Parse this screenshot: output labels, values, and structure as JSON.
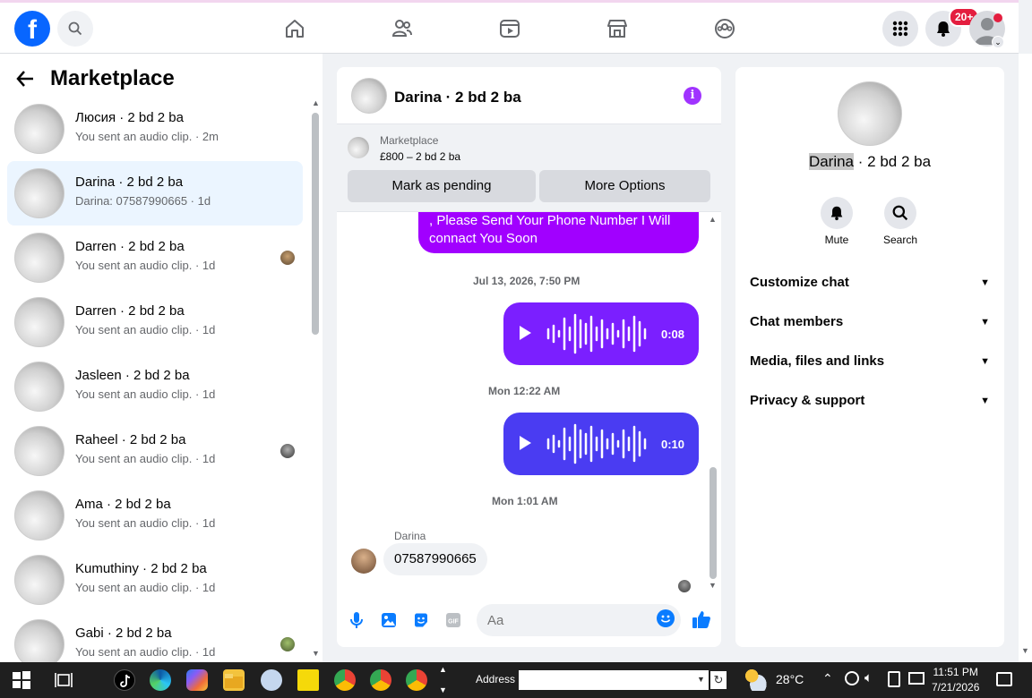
{
  "nav": {
    "logo": "f",
    "badge": "20+"
  },
  "sidebar": {
    "title": "Marketplace",
    "conversations": [
      {
        "name": "Люсия · 2 bd 2 ba",
        "sub": "You sent an audio clip. · 2m"
      },
      {
        "name": "Darina · 2 bd 2 ba",
        "sub": "Darina: 07587990665 · 1d"
      },
      {
        "name": "Darren · 2 bd 2 ba",
        "sub": "You sent an audio clip. · 1d"
      },
      {
        "name": "Darren · 2 bd 2 ba",
        "sub": "You sent an audio clip. · 1d"
      },
      {
        "name": "Jasleen · 2 bd 2 ba",
        "sub": "You sent an audio clip. · 1d"
      },
      {
        "name": "Raheel · 2 bd 2 ba",
        "sub": "You sent an audio clip. · 1d"
      },
      {
        "name": "Ama · 2 bd 2 ba",
        "sub": "You sent an audio clip. · 1d"
      },
      {
        "name": "Kumuthiny · 2 bd 2 ba",
        "sub": "You sent an audio clip. · 1d"
      },
      {
        "name": "Gabi · 2 bd 2 ba",
        "sub": "You sent an audio clip. · 1d"
      }
    ]
  },
  "chat": {
    "title": "Darina · 2 bd 2 ba",
    "marketplace_label": "Marketplace",
    "listing": "£800 – 2 bd 2 ba",
    "mark_pending": "Mark as pending",
    "more_options": "More Options",
    "sent_text": ", Please Send Your Phone Number I Will connact You Soon",
    "ts1": "Jul 13, 2026, 7:50 PM",
    "audio1_duration": "0:08",
    "ts2": "Mon 12:22 AM",
    "audio2_duration": "0:10",
    "ts3": "Mon 1:01 AM",
    "sender": "Darina",
    "received": "07587990665",
    "composer_placeholder": "Aa"
  },
  "right": {
    "name_first": "Darina",
    "name_rest": " · 2 bd 2 ba",
    "mute": "Mute",
    "search": "Search",
    "sections": [
      "Customize chat",
      "Chat members",
      "Media, files and links",
      "Privacy & support"
    ]
  },
  "taskbar": {
    "address_label": "Address",
    "temperature": "28°C",
    "time": "11:51 PM",
    "date": "7/21/2026"
  },
  "colors": {
    "brand": "#0866ff",
    "accent_purple": "#a100ff",
    "audio1": "#7b1fff",
    "audio2": "#4a3cf2"
  }
}
